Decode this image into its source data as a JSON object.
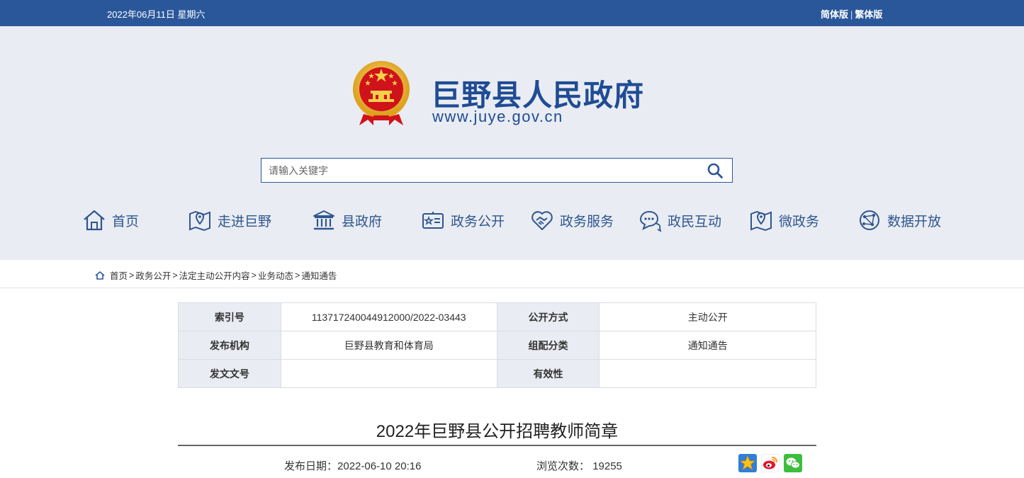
{
  "topbar": {
    "date": "2022年06月11日 星期六",
    "lang_simplified": "简体版",
    "lang_separator": "|",
    "lang_traditional": "繁体版",
    "bg_color": "#2a579a"
  },
  "header": {
    "site_title": "巨野县人民政府",
    "site_url": "www.juye.gov.cn",
    "emblem_icon": "national-emblem-icon"
  },
  "search": {
    "placeholder": "请输入关键字",
    "icon": "search-icon"
  },
  "nav": {
    "items": [
      {
        "label": "首页",
        "icon": "home-icon"
      },
      {
        "label": "走进巨野",
        "icon": "map-pin-icon"
      },
      {
        "label": "县政府",
        "icon": "government-building-icon"
      },
      {
        "label": "政务公开",
        "icon": "id-card-icon"
      },
      {
        "label": "政务服务",
        "icon": "heart-handshake-icon"
      },
      {
        "label": "政民互动",
        "icon": "chat-bubbles-icon"
      },
      {
        "label": "微政务",
        "icon": "map-pin-icon"
      },
      {
        "label": "数据开放",
        "icon": "globe-network-icon"
      }
    ]
  },
  "breadcrumb": {
    "items": [
      "首页",
      "政务公开",
      "法定主动公开内容",
      "业务动态",
      "通知通告"
    ],
    "separator": ">"
  },
  "info_table": {
    "rows": [
      {
        "k1": "索引号",
        "v1": "113717240044912000/2022-03443",
        "k2": "公开方式",
        "v2": "主动公开"
      },
      {
        "k1": "发布机构",
        "v1": "巨野县教育和体育局",
        "k2": "组配分类",
        "v2": "通知通告"
      },
      {
        "k1": "发文文号",
        "v1": "",
        "k2": "有效性",
        "v2": ""
      }
    ]
  },
  "article": {
    "title": "2022年巨野县公开招聘教师简章",
    "publish_label": "发布日期：",
    "publish_date": "2022-06-10 20:16",
    "views_label": "浏览次数：",
    "views_count": "19255",
    "share_icons": [
      "qzone-icon",
      "weibo-icon",
      "wechat-icon"
    ]
  }
}
